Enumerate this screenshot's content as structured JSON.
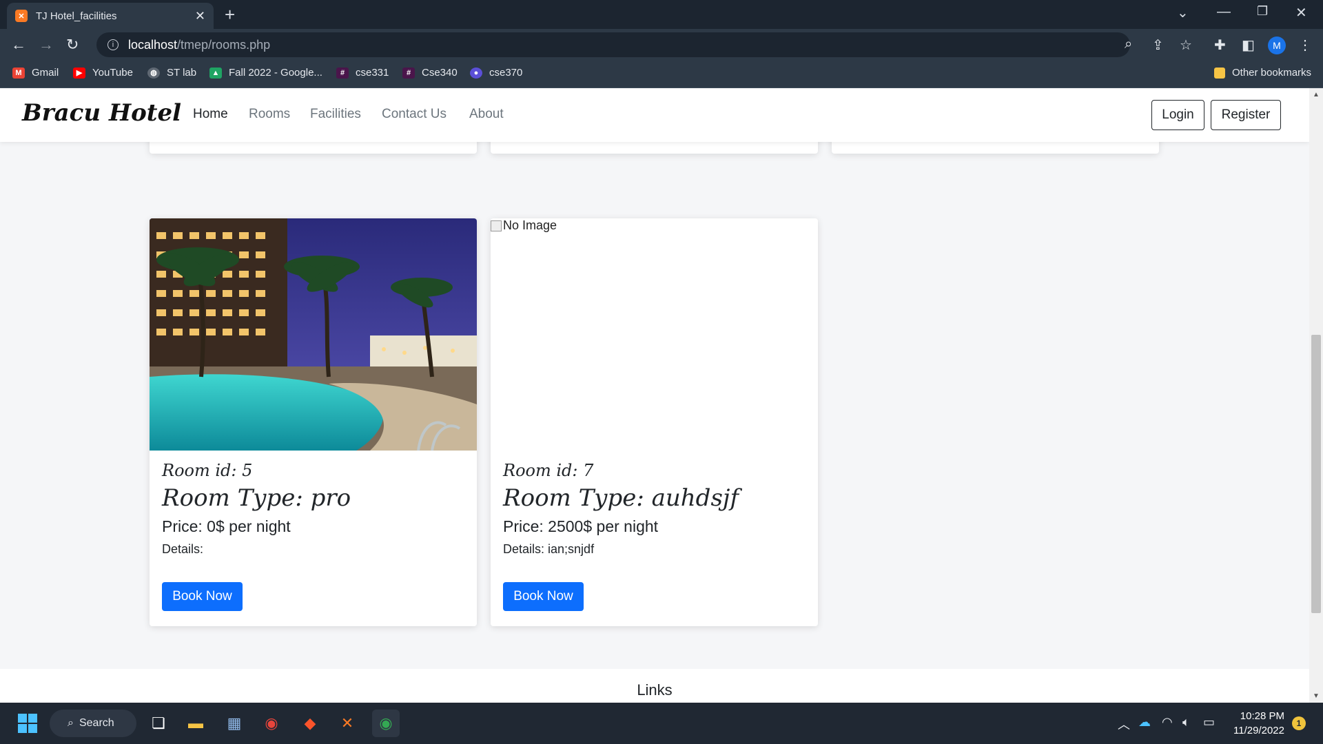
{
  "browser": {
    "tab_title": "TJ Hotel_facilities",
    "url_host": "localhost",
    "url_path": "/tmep/rooms.php",
    "bookmarks": [
      "Gmail",
      "YouTube",
      "ST lab",
      "Fall 2022 - Google...",
      "cse331",
      "Cse340",
      "cse370"
    ],
    "other_bookmarks": "Other bookmarks",
    "profile_initial": "M"
  },
  "site": {
    "brand": "Bracu Hotel",
    "nav": [
      "Home",
      "Rooms",
      "Facilities",
      "Contact Us",
      "About"
    ],
    "login": "Login",
    "register": "Register"
  },
  "rooms": {
    "book_label": "Book Now",
    "cards": [
      {
        "id_text": "Room id: 5",
        "type_text": "Room Type: pro",
        "price_text": "Price: 0$ per night",
        "details_text": "Details:",
        "image": "hotel-pool-photo"
      },
      {
        "id_text": "Room id: 7",
        "type_text": "Room Type: auhdsjf",
        "price_text": "Price: 2500$ per night",
        "details_text": "Details: ian;snjdf",
        "image_alt": "No Image"
      }
    ]
  },
  "footer": {
    "title": "Links"
  },
  "taskbar": {
    "search": "Search",
    "time": "10:28 PM",
    "date": "11/29/2022",
    "notification_count": "1"
  }
}
